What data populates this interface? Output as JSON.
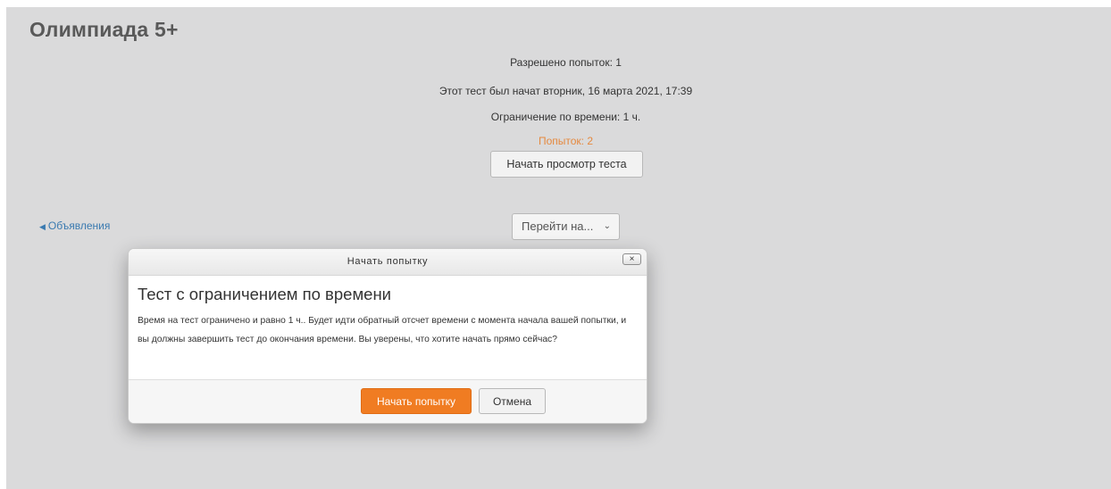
{
  "page": {
    "title": "Олимпиада 5+"
  },
  "quiz_info": {
    "attempts_allowed": "Разрешено попыток: 1",
    "started": "Этот тест был начат вторник, 16 марта 2021, 17:39",
    "time_limit": "Ограничение по времени: 1 ч.",
    "attempts_count": "Попыток: 2",
    "preview_button": "Начать просмотр теста"
  },
  "navigation": {
    "prev_link": "Объявления",
    "prev_arrow": "◀",
    "jump_select_value": "Перейти на...",
    "jump_chevron": "⌄"
  },
  "dialog": {
    "header": "Начать попытку",
    "close_label": "×",
    "title": "Тест с ограничением по времени",
    "body": "Время на тест ограничено и равно 1 ч.. Будет идти обратный отсчет времени с момента начала вашей попытки, и вы должны завершить тест до окончания времени. Вы уверены, что хотите начать прямо сейчас?",
    "start_button": "Начать попытку",
    "cancel_button": "Отмена"
  },
  "colors": {
    "background": "#dadadb",
    "accent": "#f07c22",
    "attempts_text": "#e5893f",
    "link": "#3a7ab0"
  }
}
